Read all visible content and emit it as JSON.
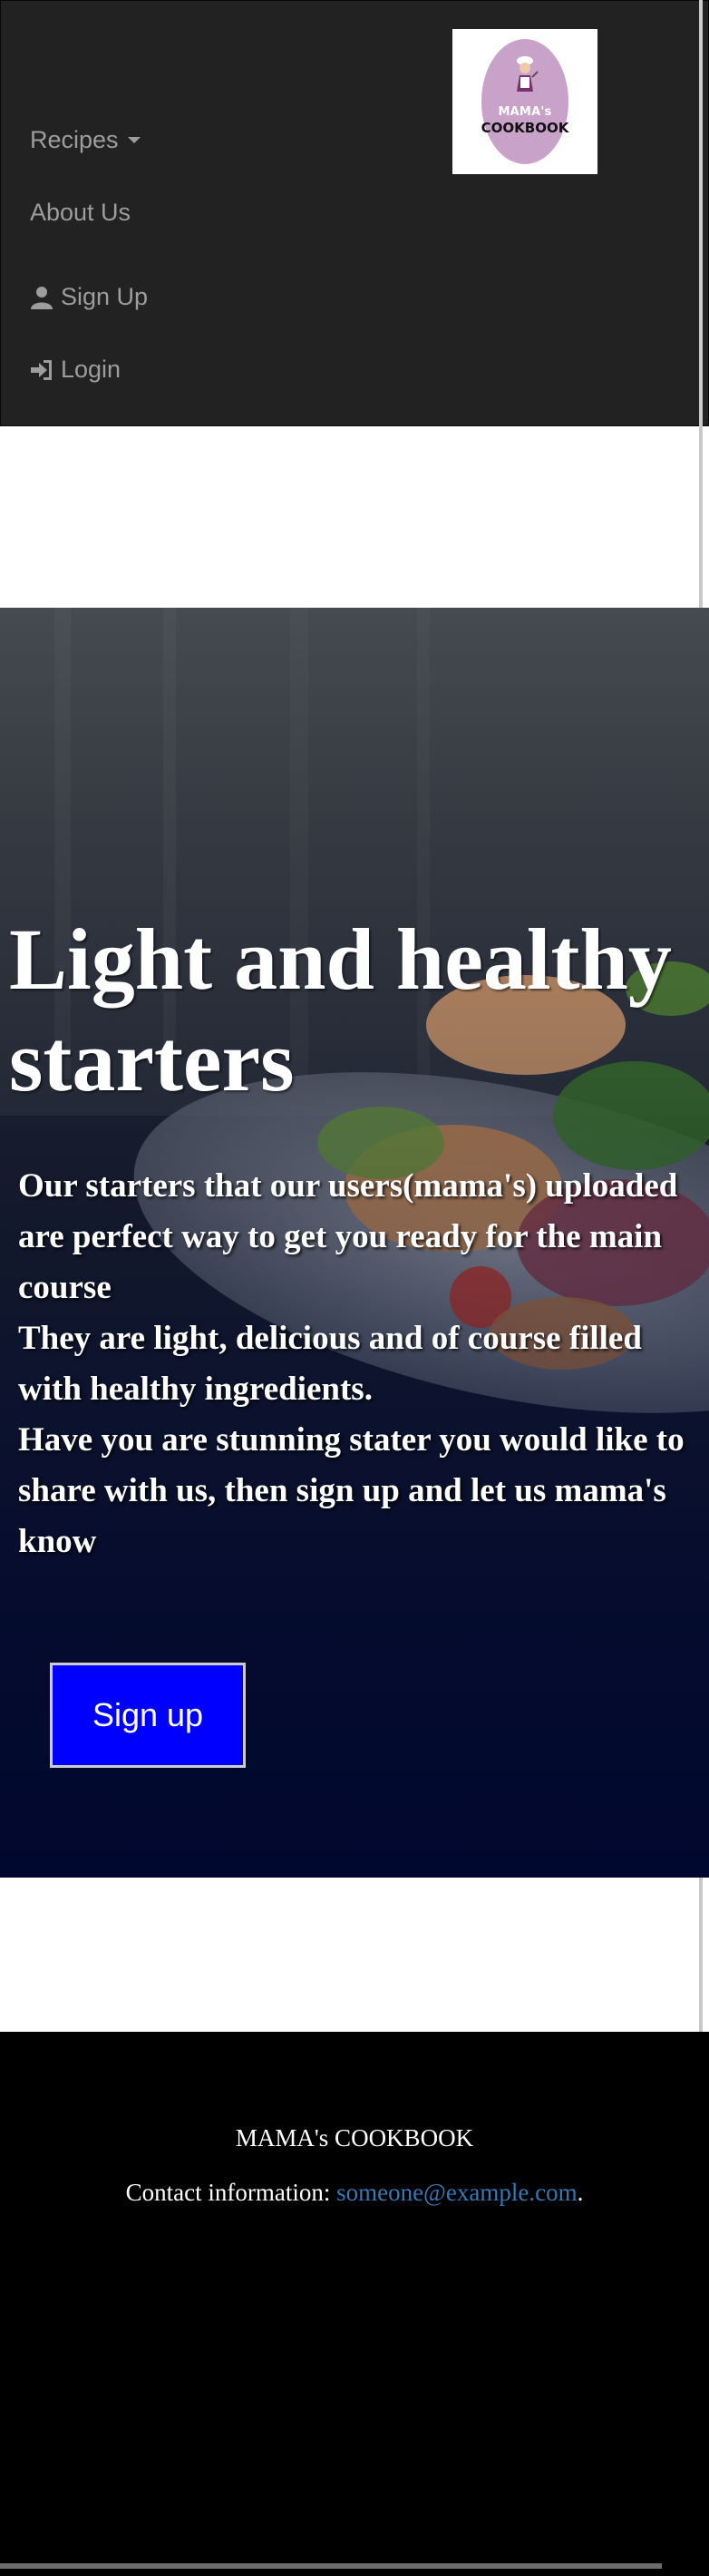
{
  "logo": {
    "line1": "MAMA's",
    "line2": "COOKBOOK"
  },
  "nav": {
    "recipes": "Recipes",
    "about": "About Us",
    "signup": "Sign Up",
    "login": "Login"
  },
  "hero": {
    "title_line1": "Light and healthy",
    "title_line2": "starters",
    "paragraphs": [
      "Our starters that our users(mama's) uploaded are perfect way to get you ready for the main course",
      "They are light, delicious and of course filled with healthy ingredients.",
      "Have you are stunning stater you would like to share with us, then sign up and let us mama's know"
    ],
    "button": "Sign up"
  },
  "footer": {
    "title": "MAMA's COOKBOOK",
    "contact_label": "Contact information: ",
    "email": "someone@example.com",
    "suffix": "."
  },
  "colors": {
    "navbar": "#222222",
    "nav_text": "#9d9d9d",
    "button": "#0000ff",
    "link": "#337ab7",
    "footer": "#000000",
    "logo_oval": "#c8a2c8"
  }
}
